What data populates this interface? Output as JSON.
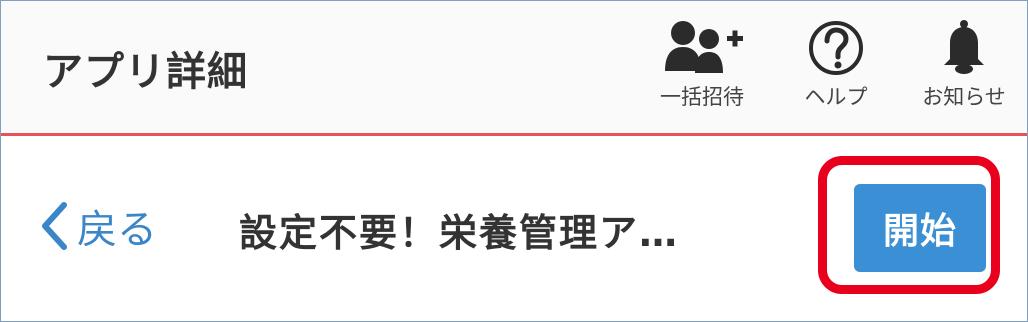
{
  "header": {
    "title": "アプリ詳細",
    "actions": [
      {
        "label": "一括招待",
        "icon": "add-users-icon"
      },
      {
        "label": "ヘルプ",
        "icon": "help-icon"
      },
      {
        "label": "お知らせ",
        "icon": "bell-icon"
      }
    ],
    "accent_color": "#e8535b"
  },
  "subbar": {
    "back_label": "戻る",
    "app_name": "設定不要！栄養管理ア…",
    "start_button": "開始",
    "start_button_color": "#3b8fd4",
    "highlight_color": "#e8001c"
  }
}
